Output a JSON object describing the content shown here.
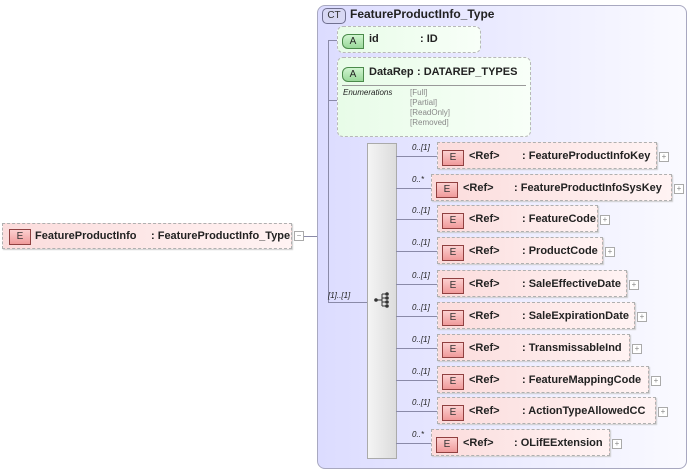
{
  "root": {
    "badge": "E",
    "name": "FeatureProductInfo",
    "type": ": FeatureProductInfo_Type",
    "collapse": "−"
  },
  "complex_type": {
    "badge": "CT",
    "name": "FeatureProductInfo_Type"
  },
  "attributes": [
    {
      "badge": "A",
      "name": "id",
      "type": ": ID"
    },
    {
      "badge": "A",
      "name": "DataRep",
      "type": ": DATAREP_TYPES",
      "enum_label": "Enumerations",
      "enums": [
        "[Full]",
        "[Partial]",
        "[ReadOnly]",
        "[Removed]"
      ]
    }
  ],
  "sequence": {
    "cardinality": "[1]..[1]",
    "icon": "sequence-icon"
  },
  "elements": [
    {
      "card": "0..[1]",
      "ref": "<Ref>",
      "name": ": FeatureProductInfoKey"
    },
    {
      "card": "0..*",
      "ref": "<Ref>",
      "name": ": FeatureProductInfoSysKey"
    },
    {
      "card": "0..[1]",
      "ref": "<Ref>",
      "name": ": FeatureCode"
    },
    {
      "card": "0..[1]",
      "ref": "<Ref>",
      "name": ": ProductCode"
    },
    {
      "card": "0..[1]",
      "ref": "<Ref>",
      "name": ": SaleEffectiveDate"
    },
    {
      "card": "0..[1]",
      "ref": "<Ref>",
      "name": ": SaleExpirationDate"
    },
    {
      "card": "0..[1]",
      "ref": "<Ref>",
      "name": ": TransmissableInd"
    },
    {
      "card": "0..[1]",
      "ref": "<Ref>",
      "name": ": FeatureMappingCode"
    },
    {
      "card": "0..[1]",
      "ref": "<Ref>",
      "name": ": ActionTypeAllowedCC"
    },
    {
      "card": "0..*",
      "ref": "<Ref>",
      "name": ": OLifEExtension"
    }
  ],
  "expand_symbol": "+"
}
